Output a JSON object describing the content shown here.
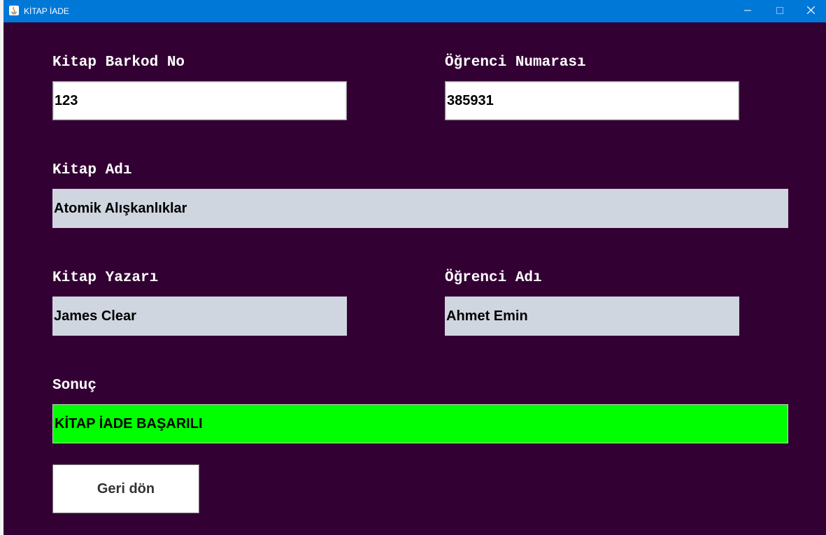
{
  "window": {
    "title": "KİTAP İADE",
    "controls": {
      "minimize_icon": "minimize-icon",
      "maximize_icon": "maximize-icon",
      "close_icon": "close-icon"
    }
  },
  "form": {
    "barcode": {
      "label": "Kitap Barkod No",
      "value": "123"
    },
    "student_number": {
      "label": "Öğrenci Numarası",
      "value": "385931"
    },
    "book_title": {
      "label": "Kitap Adı",
      "value": "Atomik Alışkanlıklar"
    },
    "book_author": {
      "label": "Kitap Yazarı",
      "value": "James Clear"
    },
    "student_name": {
      "label": "Öğrenci Adı",
      "value": "Ahmet Emin"
    },
    "result": {
      "label": "Sonuç",
      "value": "KİTAP İADE BAŞARILI"
    }
  },
  "actions": {
    "back_label": "Geri dön"
  },
  "colors": {
    "background": "#330033",
    "titlebar": "#0078d7",
    "readonly_field": "#cfd6e0",
    "result_success": "#00ff00"
  }
}
